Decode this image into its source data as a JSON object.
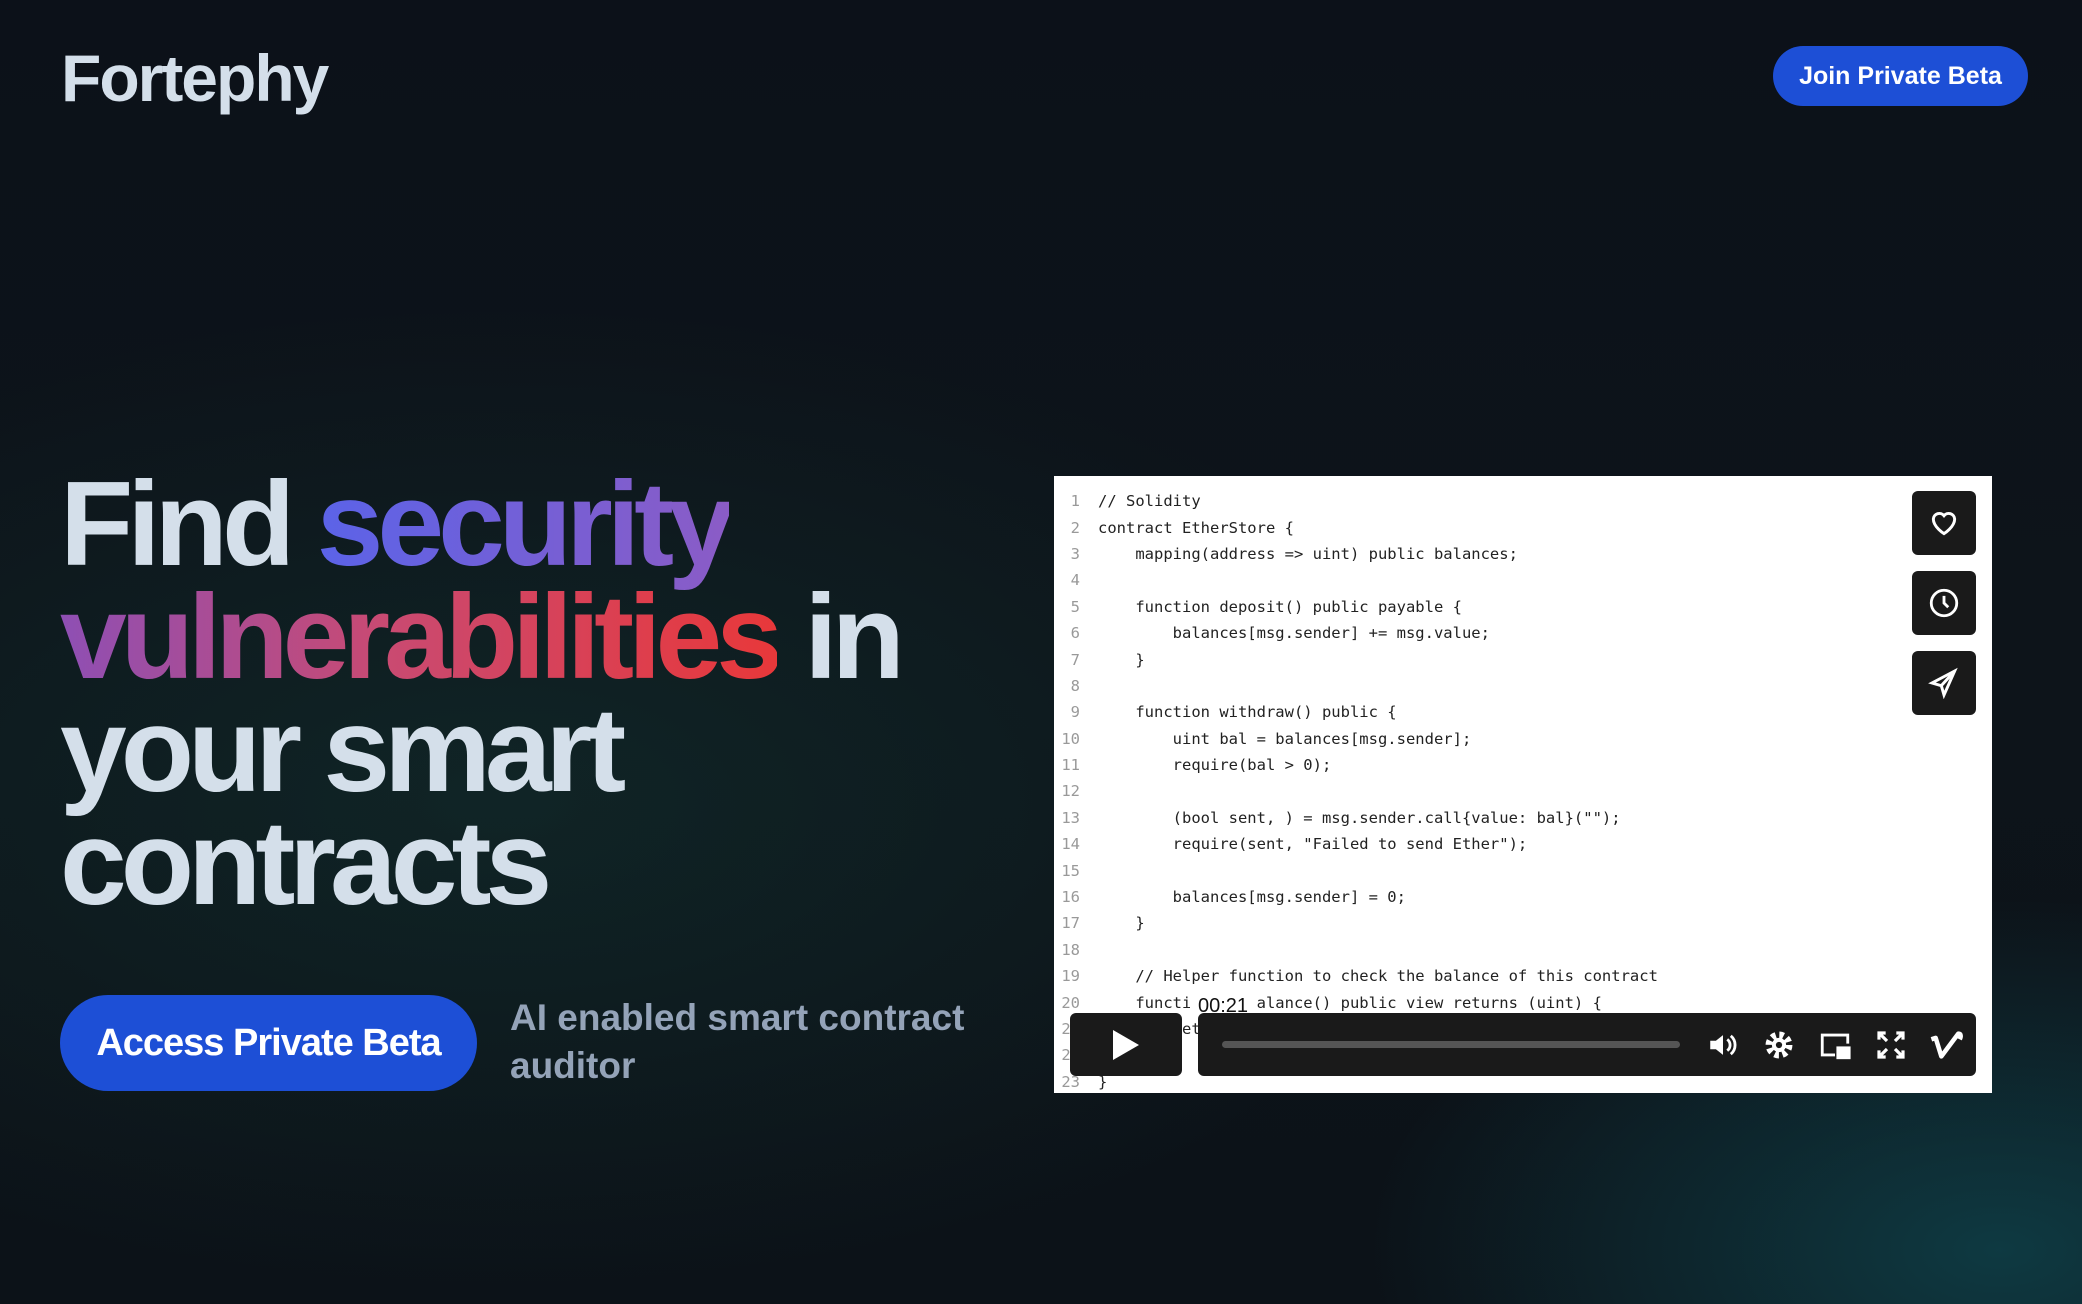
{
  "header": {
    "logo": "Fortephy",
    "join_label": "Join Private Beta"
  },
  "hero": {
    "headline": {
      "part1": "Find ",
      "part2": "security",
      "part3": "vulnerabilities",
      "part4": " in",
      "part5": "your smart",
      "part6": "contracts"
    },
    "cta_label": "Access Private Beta",
    "subtitle": "AI enabled smart contract auditor"
  },
  "video": {
    "code_lines": [
      {
        "n": "1",
        "t": "// Solidity"
      },
      {
        "n": "2",
        "t": "contract EtherStore {"
      },
      {
        "n": "3",
        "t": "    mapping(address => uint) public balances;"
      },
      {
        "n": "4",
        "t": ""
      },
      {
        "n": "5",
        "t": "    function deposit() public payable {"
      },
      {
        "n": "6",
        "t": "        balances[msg.sender] += msg.value;"
      },
      {
        "n": "7",
        "t": "    }"
      },
      {
        "n": "8",
        "t": ""
      },
      {
        "n": "9",
        "t": "    function withdraw() public {"
      },
      {
        "n": "10",
        "t": "        uint bal = balances[msg.sender];"
      },
      {
        "n": "11",
        "t": "        require(bal > 0);"
      },
      {
        "n": "12",
        "t": ""
      },
      {
        "n": "13",
        "t": "        (bool sent, ) = msg.sender.call{value: bal}(\"\");"
      },
      {
        "n": "14",
        "t": "        require(sent, \"Failed to send Ether\");"
      },
      {
        "n": "15",
        "t": ""
      },
      {
        "n": "16",
        "t": "        balances[msg.sender] = 0;"
      },
      {
        "n": "17",
        "t": "    }"
      },
      {
        "n": "18",
        "t": ""
      },
      {
        "n": "19",
        "t": "    // Helper function to check the balance of this contract"
      },
      {
        "n": "20",
        "t": "    function getBalance() public view returns (uint) {"
      },
      {
        "n": "21",
        "t": "        return address(this).balance;"
      },
      {
        "n": "22",
        "t": "    }"
      },
      {
        "n": "23",
        "t": "}"
      }
    ],
    "time_tooltip": "00:21",
    "progress": 0,
    "side_buttons": [
      "heart-icon",
      "clock-icon",
      "send-icon"
    ],
    "controls": [
      "volume-icon",
      "settings-icon",
      "pip-icon",
      "fullscreen-icon",
      "vimeo-icon"
    ]
  }
}
